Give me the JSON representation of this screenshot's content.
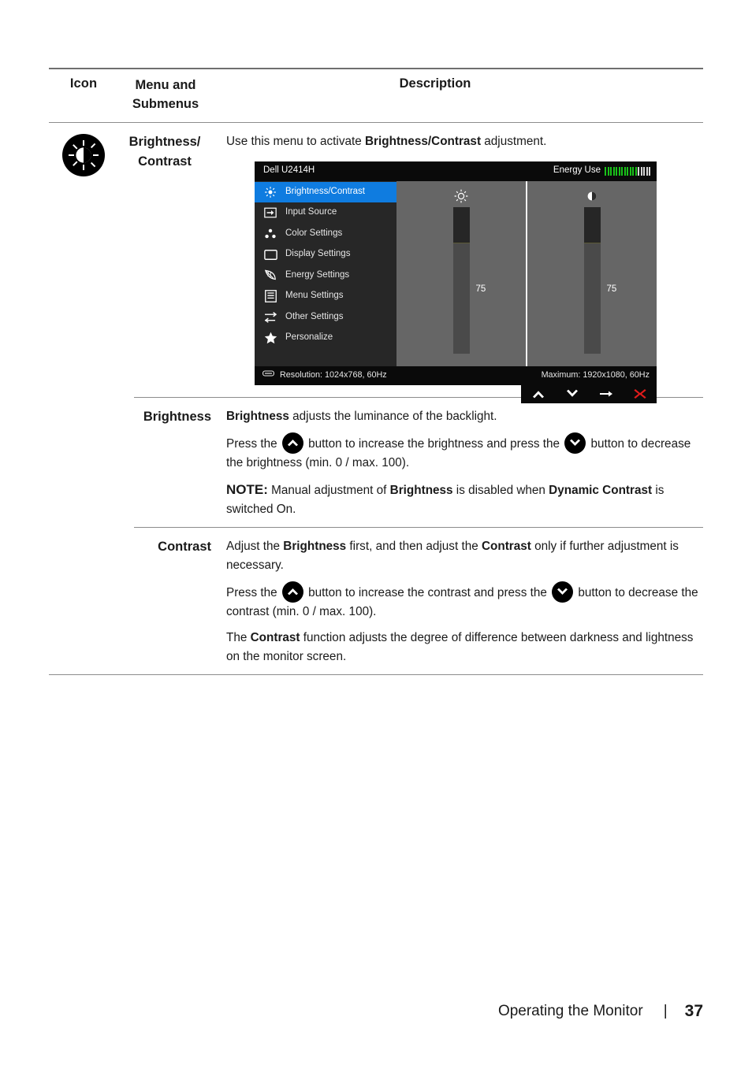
{
  "table": {
    "headers": {
      "icon": "Icon",
      "menu_line1": "Menu and",
      "menu_line2": "Submenus",
      "description": "Description"
    },
    "rows": {
      "brightness_contrast": {
        "icon_name": "brightness-contrast-icon",
        "label_line1": "Brightness/",
        "label_line2": "Contrast",
        "intro_pre": "Use this menu to activate ",
        "intro_bold": "Brightness/Contrast",
        "intro_post": " adjustment."
      },
      "brightness": {
        "label": "Brightness",
        "p1_bold": "Brightness",
        "p1_rest": " adjusts the luminance of the backlight.",
        "p2_a": "Press the",
        "p2_b": "button to increase the brightness and press the",
        "p2_c": "button to decrease the brightness (min. 0 / max. 100).",
        "note_label": "NOTE:",
        "note_a": " Manual adjustment of ",
        "note_b": "Brightness",
        "note_c": " is disabled when ",
        "note_d": "Dynamic Contrast",
        "note_e": " is switched On."
      },
      "contrast": {
        "label": "Contrast",
        "p1_a": "Adjust the ",
        "p1_b": "Brightness",
        "p1_c": " first, and then adjust the ",
        "p1_d": "Contrast",
        "p1_e": " only if further adjustment is necessary.",
        "p2_a": "Press the",
        "p2_b": "button to increase the contrast and press the",
        "p2_c": "button to decrease the contrast (min. 0 / max. 100).",
        "p3_a": "The ",
        "p3_b": "Contrast",
        "p3_c": " function adjusts the degree of difference between darkness and lightness on the monitor screen."
      }
    }
  },
  "osd": {
    "model": "Dell U2414H",
    "energy_label": "Energy Use",
    "energy_bars_on": 12,
    "energy_bars_off": 5,
    "selected_color": "#0f7ce0",
    "menu_items": [
      {
        "label": "Brightness/Contrast",
        "icon": "sun-icon",
        "selected": true
      },
      {
        "label": "Input Source",
        "icon": "input-arrow-icon",
        "selected": false
      },
      {
        "label": "Color Settings",
        "icon": "color-dots-icon",
        "selected": false
      },
      {
        "label": "Display Settings",
        "icon": "monitor-icon",
        "selected": false
      },
      {
        "label": "Energy Settings",
        "icon": "leaf-icon",
        "selected": false
      },
      {
        "label": "Menu Settings",
        "icon": "menu-list-icon",
        "selected": false
      },
      {
        "label": "Other Settings",
        "icon": "sliders-icon",
        "selected": false
      },
      {
        "label": "Personalize",
        "icon": "star-icon",
        "selected": false
      }
    ],
    "panes": [
      {
        "name": "brightness",
        "icon": "sun-icon",
        "value": "75",
        "percent": 75
      },
      {
        "name": "contrast",
        "icon": "contrast-icon",
        "value": "75",
        "percent": 75
      }
    ],
    "footer": {
      "resolution": "Resolution: 1024x768, 60Hz",
      "maximum": "Maximum: 1920x1080, 60Hz"
    },
    "navbar": [
      {
        "name": "up",
        "glyph": "chevron-up-icon"
      },
      {
        "name": "down",
        "glyph": "chevron-down-icon"
      },
      {
        "name": "enter",
        "glyph": "arrow-right-icon"
      },
      {
        "name": "exit",
        "glyph": "close-x-icon"
      }
    ],
    "exit_color": "#e01b1b"
  },
  "footer": {
    "section": "Operating the Monitor",
    "separator": "|",
    "page": "37"
  }
}
